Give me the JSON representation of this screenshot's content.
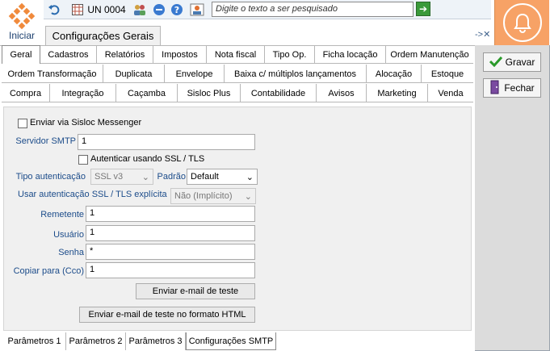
{
  "app": {
    "start_label": "Iniciar"
  },
  "toolbar": {
    "unit": "UN 0004",
    "search_placeholder": "Digite o texto a ser pesquisado"
  },
  "window_tab": {
    "label": "Configurações Gerais"
  },
  "tabs_row1": [
    "Geral",
    "Cadastros",
    "Relatórios",
    "Impostos",
    "Nota fiscal",
    "Tipo Op.",
    "Ficha locação",
    "Ordem Manutenção"
  ],
  "tabs_row2": [
    "Ordem Transformação",
    "Duplicata",
    "Envelope",
    "Baixa c/ múltiplos lançamentos",
    "Alocação",
    "Estoque"
  ],
  "tabs_row3": [
    "Compra",
    "Integração",
    "Caçamba",
    "Sisloc Plus",
    "Contabilidade",
    "Avisos",
    "Marketing",
    "Venda"
  ],
  "form": {
    "send_messenger": "Enviar via Sisloc Messenger",
    "smtp_label": "Servidor SMTP",
    "smtp_value": "1",
    "ssl_auth": "Autenticar usando SSL / TLS",
    "auth_type_label": "Tipo autenticação",
    "auth_type_value": "SSL v3",
    "padrao_label": "Padrão",
    "padrao_value": "Default",
    "explicit_label": "Usar autenticação SSL / TLS explícita",
    "explicit_value": "Não (Implícito)",
    "sender_label": "Remetente",
    "sender_value": "1",
    "user_label": "Usuário",
    "user_value": "1",
    "password_label": "Senha",
    "password_value": "*",
    "cc_label": "Copiar para (Cco)",
    "cc_value": "1",
    "test_button": "Enviar e-mail de teste",
    "test_html_button": "Enviar e-mail de teste no formato HTML"
  },
  "bottom_tabs": [
    "Parâmetros 1",
    "Parâmetros 2",
    "Parâmetros 3",
    "Configurações SMTP"
  ],
  "side": {
    "save": "Gravar",
    "close": "Fechar"
  },
  "colors": {
    "accent_orange": "#f7a266",
    "label_blue": "#1c4c8a"
  }
}
